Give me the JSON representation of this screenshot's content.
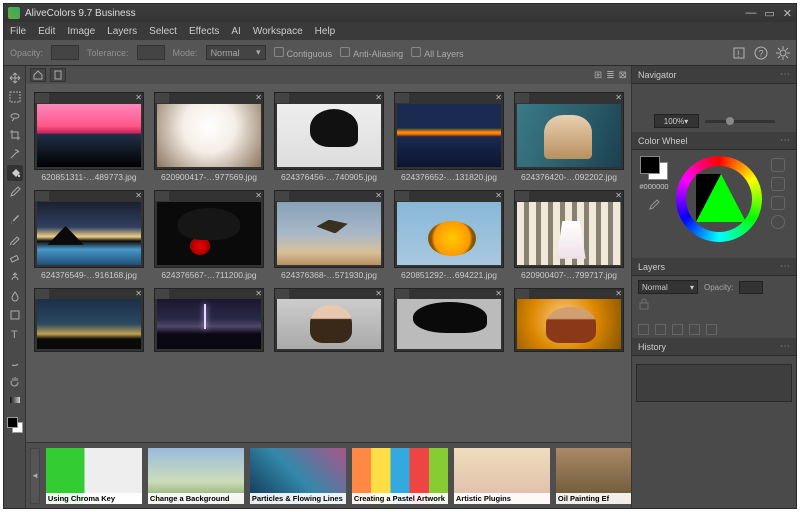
{
  "title": "AliveColors 9.7 Business",
  "menu": [
    "File",
    "Edit",
    "Image",
    "Layers",
    "Select",
    "Effects",
    "AI",
    "Workspace",
    "Help"
  ],
  "opt": {
    "opacity_l": "Opacity:",
    "opacity_v": "",
    "tol_l": "Tolerance:",
    "tol_v": "",
    "mode_l": "Mode:",
    "mode_v": "Normal",
    "contig": "Contiguous",
    "anti": "Anti-Aliasing",
    "all": "All Layers"
  },
  "thumbs": [
    [
      {
        "cls": "t-sunset-pink",
        "cap": "620851311-…489773.jpg"
      },
      {
        "cls": "t-ballerina",
        "cap": "620900417-…977569.jpg"
      },
      {
        "cls": "t-hat",
        "cap": "624376456-…740905.jpg"
      },
      {
        "cls": "t-lake",
        "cap": "624376652-…131820.jpg"
      },
      {
        "cls": "t-chair",
        "cap": "624376420-…092202.jpg"
      }
    ],
    [
      {
        "cls": "t-mtn",
        "cap": "624376549-…916168.jpg"
      },
      {
        "cls": "t-rose",
        "cap": "624376567-…711200.jpg"
      },
      {
        "cls": "t-bird",
        "cap": "624376368-…571930.jpg"
      },
      {
        "cls": "t-sunfl",
        "cap": "620851292-…694221.jpg"
      },
      {
        "cls": "t-cols",
        "cap": "620900407-…799717.jpg"
      }
    ],
    [
      {
        "cls": "t-arch",
        "cap": ""
      },
      {
        "cls": "t-storm",
        "cap": ""
      },
      {
        "cls": "t-woman",
        "cap": ""
      },
      {
        "cls": "t-hat2",
        "cap": ""
      },
      {
        "cls": "t-gold",
        "cap": ""
      }
    ]
  ],
  "bottom": [
    {
      "cls": "b1",
      "lab": "Using Chroma Key"
    },
    {
      "cls": "b2",
      "lab": "Change a Background"
    },
    {
      "cls": "b3",
      "lab": "Particles & Flowing Lines"
    },
    {
      "cls": "b4",
      "lab": "Creating a Pastel Artwork"
    },
    {
      "cls": "b5",
      "lab": "Artistic Plugins"
    },
    {
      "cls": "b6",
      "lab": "Oil Painting Ef"
    }
  ],
  "panels": {
    "nav": "Navigator",
    "zoom": "100%",
    "cw": "Color Wheel",
    "hex": "#000000",
    "layers": "Layers",
    "blend": "Normal",
    "opac": "Opacity:",
    "hist": "History"
  }
}
